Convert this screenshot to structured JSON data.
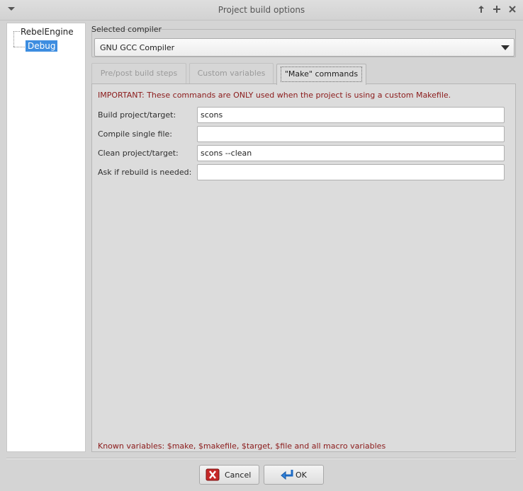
{
  "window": {
    "title": "Project build options"
  },
  "tree": {
    "root": "RebelEngine",
    "child": "Debug"
  },
  "compiler": {
    "group_label": "Selected compiler",
    "selected": "GNU GCC Compiler"
  },
  "tabs": [
    {
      "label": "Pre/post build steps"
    },
    {
      "label": "Custom variables"
    },
    {
      "label": "\"Make\" commands"
    }
  ],
  "make": {
    "important_note": "IMPORTANT: These commands are ONLY used when the project is using a custom Makefile.",
    "rows": [
      {
        "label": "Build project/target:",
        "value": "scons"
      },
      {
        "label": "Compile single file:",
        "value": ""
      },
      {
        "label": "Clean project/target:",
        "value": "scons --clean"
      },
      {
        "label": "Ask if rebuild is needed:",
        "value": ""
      }
    ],
    "known_variables": "Known variables: $make, $makefile, $target, $file and all macro variables"
  },
  "buttons": {
    "cancel": "Cancel",
    "ok": "OK"
  },
  "icons": {
    "cancel": "red-x-icon",
    "ok": "blue-return-arrow-icon"
  },
  "colors": {
    "selection": "#3d8de0",
    "note_text": "#8b1a1a"
  }
}
